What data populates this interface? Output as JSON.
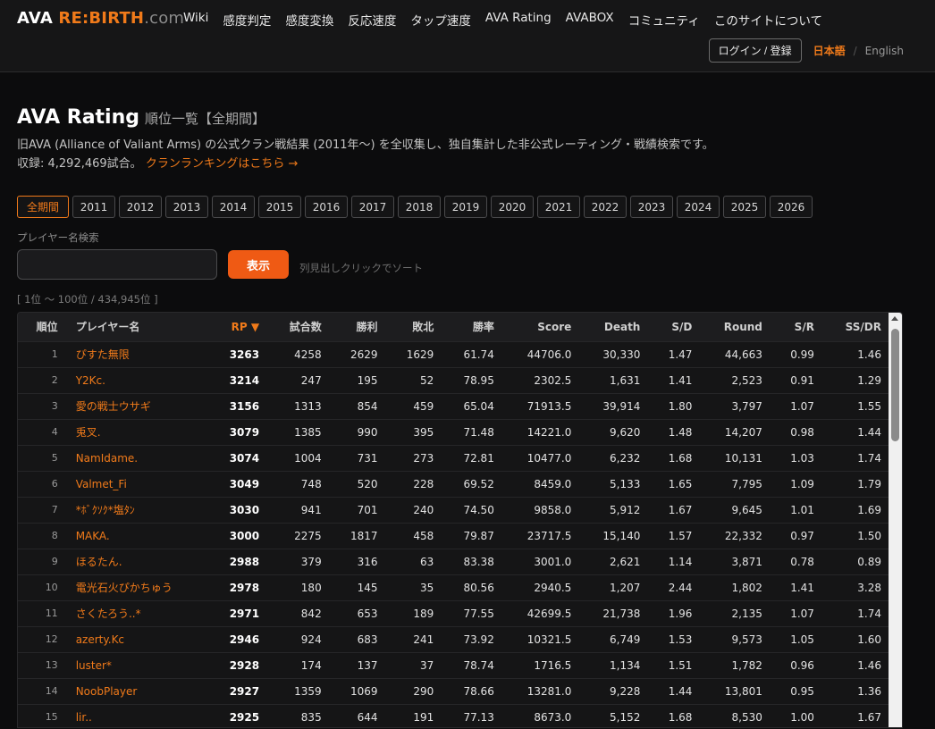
{
  "header": {
    "logo_a": "AVA ",
    "logo_b": "RE:BIRTH",
    "logo_c": ".com",
    "nav": [
      "Wiki",
      "感度判定",
      "感度変換",
      "反応速度",
      "タップ速度",
      "AVA Rating",
      "AVABOX",
      "コミュニティ",
      "このサイトについて"
    ],
    "login_label": "ログイン / 登録",
    "lang_ja": "日本語",
    "lang_sep": "/",
    "lang_en": "English"
  },
  "page": {
    "title": "AVA Rating",
    "subtitle": "順位一覧【全期間】",
    "description": "旧AVA (Alliance of Valiant Arms) の公式クラン戦結果 (2011年〜) を全収集し、独自集計した非公式レーティング・戦績検索です。 収録: 4,292,469試合。 ",
    "clan_link": "クランランキングはこちら →"
  },
  "years": [
    "全期間",
    "2011",
    "2012",
    "2013",
    "2014",
    "2015",
    "2016",
    "2017",
    "2018",
    "2019",
    "2020",
    "2021",
    "2022",
    "2023",
    "2024",
    "2025",
    "2026"
  ],
  "search": {
    "label": "プレイヤー名検索",
    "value": "",
    "placeholder": "",
    "button_label": "表示",
    "sort_hint": "列見出しクリックでソート"
  },
  "range_text": "[ 1位 〜 100位 / 434,945位 ]",
  "table": {
    "columns": [
      "順位",
      "プレイヤー名",
      "RP ▼",
      "試合数",
      "勝利",
      "敗北",
      "勝率",
      "Score",
      "Death",
      "S/D",
      "Round",
      "S/R",
      "SS/DR"
    ],
    "rows": [
      [
        "1",
        "ぴすた無限",
        "3263",
        "4258",
        "2629",
        "1629",
        "61.74",
        "44706.0",
        "30,330",
        "1.47",
        "44,663",
        "0.99",
        "1.46"
      ],
      [
        "2",
        "Y2Kc.",
        "3214",
        "247",
        "195",
        "52",
        "78.95",
        "2302.5",
        "1,631",
        "1.41",
        "2,523",
        "0.91",
        "1.29"
      ],
      [
        "3",
        "愛の戦士ウサギ",
        "3156",
        "1313",
        "854",
        "459",
        "65.04",
        "71913.5",
        "39,914",
        "1.80",
        "3,797",
        "1.07",
        "1.55"
      ],
      [
        "4",
        "兎叉.",
        "3079",
        "1385",
        "990",
        "395",
        "71.48",
        "14221.0",
        "9,620",
        "1.48",
        "14,207",
        "0.98",
        "1.44"
      ],
      [
        "5",
        "NamIdame.",
        "3074",
        "1004",
        "731",
        "273",
        "72.81",
        "10477.0",
        "6,232",
        "1.68",
        "10,131",
        "1.03",
        "1.74"
      ],
      [
        "6",
        "Valmet_Fi",
        "3049",
        "748",
        "520",
        "228",
        "69.52",
        "8459.0",
        "5,133",
        "1.65",
        "7,795",
        "1.09",
        "1.79"
      ],
      [
        "7",
        "*ﾎﾞｸｿｸ*塩ﾀﾝ",
        "3030",
        "941",
        "701",
        "240",
        "74.50",
        "9858.0",
        "5,912",
        "1.67",
        "9,645",
        "1.01",
        "1.69"
      ],
      [
        "8",
        "MAKA.",
        "3000",
        "2275",
        "1817",
        "458",
        "79.87",
        "23717.5",
        "15,140",
        "1.57",
        "22,332",
        "0.97",
        "1.50"
      ],
      [
        "9",
        "ほるたん.",
        "2988",
        "379",
        "316",
        "63",
        "83.38",
        "3001.0",
        "2,621",
        "1.14",
        "3,871",
        "0.78",
        "0.89"
      ],
      [
        "10",
        "電光石火ぴかちゅう",
        "2978",
        "180",
        "145",
        "35",
        "80.56",
        "2940.5",
        "1,207",
        "2.44",
        "1,802",
        "1.41",
        "3.28"
      ],
      [
        "11",
        "さくたろう..*",
        "2971",
        "842",
        "653",
        "189",
        "77.55",
        "42699.5",
        "21,738",
        "1.96",
        "2,135",
        "1.07",
        "1.74"
      ],
      [
        "12",
        "azerty.Kc",
        "2946",
        "924",
        "683",
        "241",
        "73.92",
        "10321.5",
        "6,749",
        "1.53",
        "9,573",
        "1.05",
        "1.60"
      ],
      [
        "13",
        "luster*",
        "2928",
        "174",
        "137",
        "37",
        "78.74",
        "1716.5",
        "1,134",
        "1.51",
        "1,782",
        "0.96",
        "1.46"
      ],
      [
        "14",
        "NoobPlayer",
        "2927",
        "1359",
        "1069",
        "290",
        "78.66",
        "13281.0",
        "9,228",
        "1.44",
        "13,801",
        "0.95",
        "1.36"
      ],
      [
        "15",
        "lir..",
        "2925",
        "835",
        "644",
        "191",
        "77.13",
        "8673.0",
        "5,152",
        "1.68",
        "8,530",
        "1.00",
        "1.67"
      ]
    ]
  },
  "colors": {
    "accent": "#f07a1a",
    "button": "#ef5a14",
    "background": "#0c0c0d"
  }
}
